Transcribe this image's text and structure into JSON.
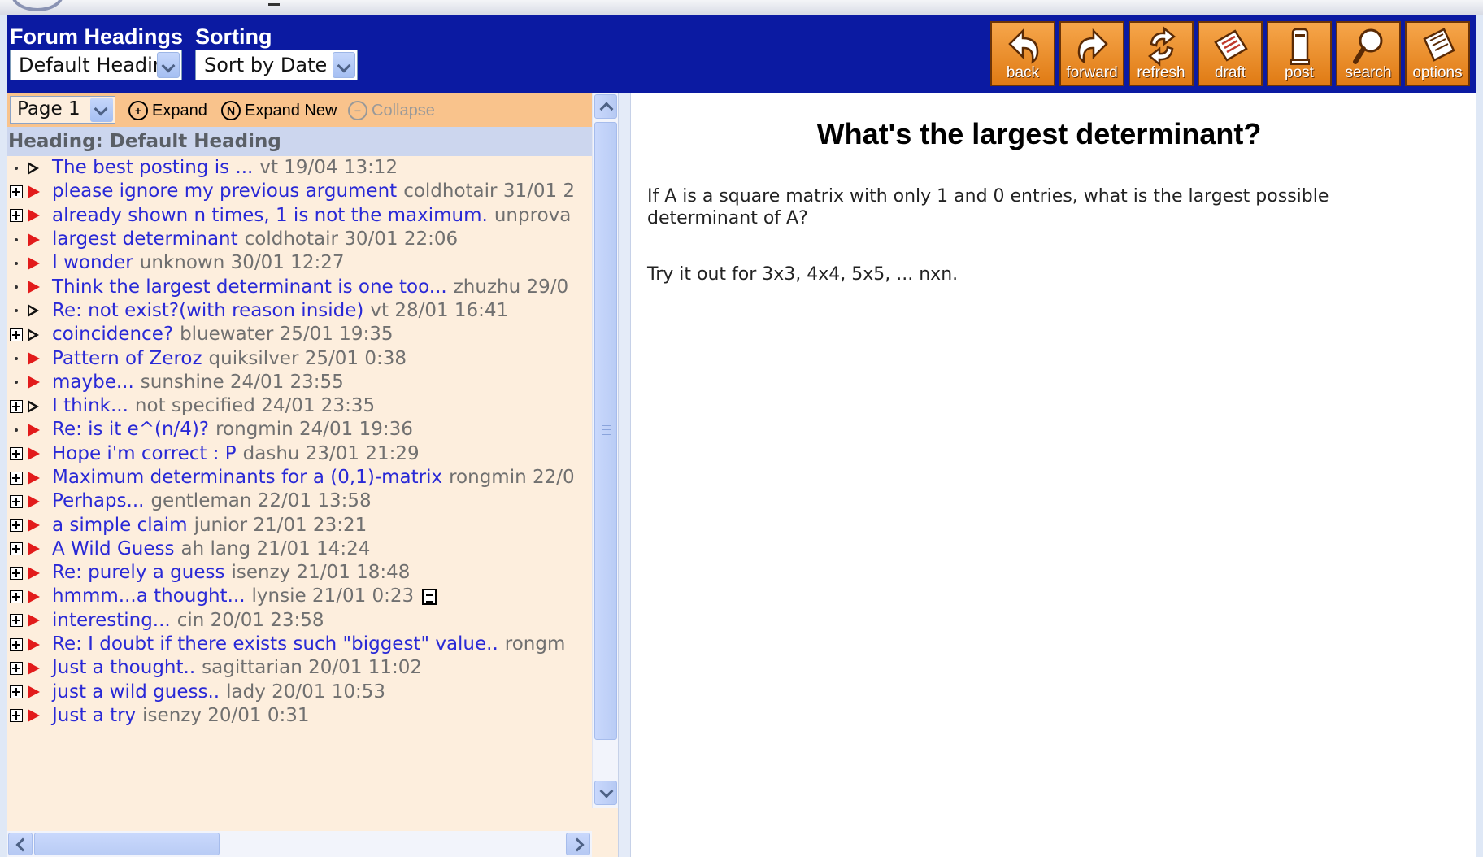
{
  "header": {
    "headings_label": "Forum Headings",
    "headings_value": "Default Heading",
    "sorting_label": "Sorting",
    "sorting_value": "Sort by Date"
  },
  "toolbar": [
    {
      "label": "back",
      "icon": "back-arrow-icon"
    },
    {
      "label": "forward",
      "icon": "forward-arrow-icon"
    },
    {
      "label": "refresh",
      "icon": "refresh-icon"
    },
    {
      "label": "draft",
      "icon": "draft-icon"
    },
    {
      "label": "post",
      "icon": "mailbox-icon"
    },
    {
      "label": "search",
      "icon": "magnifier-icon"
    },
    {
      "label": "options",
      "icon": "options-icon"
    }
  ],
  "pager": {
    "page_value": "Page 1",
    "expand_label": "Expand",
    "expand_new_label": "Expand New",
    "collapse_label": "Collapse"
  },
  "heading_label": "Heading: Default Heading",
  "threads": [
    {
      "title": "The best posting is ...",
      "meta": "vt 19/04 13:12",
      "expand": "dot",
      "flag": "read"
    },
    {
      "title": "please ignore my previous argument",
      "meta": "coldhotair 31/01 2",
      "expand": "plus",
      "flag": "red"
    },
    {
      "title": "already shown n times, 1 is not the maximum.",
      "meta": "unprova",
      "expand": "plus",
      "flag": "red"
    },
    {
      "title": "largest determinant",
      "meta": "coldhotair 30/01 22:06",
      "expand": "dot",
      "flag": "red"
    },
    {
      "title": "I wonder",
      "meta": "unknown 30/01 12:27",
      "expand": "dot",
      "flag": "red"
    },
    {
      "title": "Think the largest determinant is one too...",
      "meta": "zhuzhu 29/0",
      "expand": "dot",
      "flag": "red"
    },
    {
      "title": "Re: not exist?(with reason inside)",
      "meta": "vt 28/01 16:41",
      "expand": "dot",
      "flag": "read"
    },
    {
      "title": "coincidence?",
      "meta": "bluewater 25/01 19:35",
      "expand": "plus",
      "flag": "read"
    },
    {
      "title": "Pattern of Zeroz",
      "meta": "quiksilver 25/01 0:38",
      "expand": "dot",
      "flag": "red"
    },
    {
      "title": "maybe...",
      "meta": "sunshine 24/01 23:55",
      "expand": "dot",
      "flag": "red"
    },
    {
      "title": "I think...",
      "meta": "not specified 24/01 23:35",
      "expand": "plus",
      "flag": "read"
    },
    {
      "title": "Re: is it e^(n/4)?",
      "meta": "rongmin 24/01 19:36",
      "expand": "dot",
      "flag": "red"
    },
    {
      "title": "Hope i'm correct : P",
      "meta": "dashu 23/01 21:29",
      "expand": "plus",
      "flag": "red"
    },
    {
      "title": "Maximum determinants for a (0,1)-matrix",
      "meta": "rongmin 22/0",
      "expand": "plus",
      "flag": "red"
    },
    {
      "title": "Perhaps...",
      "meta": "gentleman 22/01 13:58",
      "expand": "plus",
      "flag": "red"
    },
    {
      "title": "a simple claim",
      "meta": "junior 21/01 23:21",
      "expand": "plus",
      "flag": "red"
    },
    {
      "title": "A Wild Guess",
      "meta": "ah lang 21/01 14:24",
      "expand": "plus",
      "flag": "red"
    },
    {
      "title": "Re: purely a guess",
      "meta": "isenzy 21/01 18:48",
      "expand": "plus",
      "flag": "red"
    },
    {
      "title": "hmmm...a thought...",
      "meta": "lynsie 21/01 0:23",
      "expand": "plus",
      "flag": "red",
      "attachment": "document-icon"
    },
    {
      "title": "interesting...",
      "meta": "cin 20/01 23:58",
      "expand": "plus",
      "flag": "red"
    },
    {
      "title": "Re: I doubt if there exists such \"biggest\" value..",
      "meta": "rongm",
      "expand": "plus",
      "flag": "red"
    },
    {
      "title": "Just a thought..",
      "meta": "sagittarian 20/01 11:02",
      "expand": "plus",
      "flag": "red"
    },
    {
      "title": "just a wild guess..",
      "meta": "lady 20/01 10:53",
      "expand": "plus",
      "flag": "red"
    },
    {
      "title": "Just a try",
      "meta": "isenzy 20/01 0:31",
      "expand": "plus",
      "flag": "red"
    }
  ],
  "post": {
    "title": "What's the largest determinant?",
    "body_1": "If A is a square matrix with only 1 and 0 entries, what is the largest possible determinant of A?",
    "body_2": "Try it out for 3x3, 4x4, 5x5, ... nxn."
  },
  "colors": {
    "header_bg": "#0b1aa2",
    "toolbar_button": "#e88a22",
    "thread_link": "#2929d6",
    "thread_meta": "#707070",
    "flag_new": "#e21b1b",
    "list_bg": "#fdeedd",
    "pager_bg": "#f9c38c"
  }
}
